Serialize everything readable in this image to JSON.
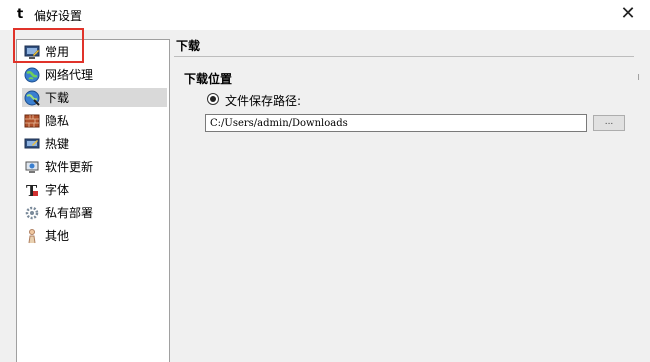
{
  "window": {
    "app_icon": "t",
    "title": "偏好设置",
    "close_glyph": "✕"
  },
  "sidebar": {
    "items": [
      {
        "label": "常用",
        "icon": "monitor-icon",
        "active": false
      },
      {
        "label": "网络代理",
        "icon": "globe-icon",
        "active": false
      },
      {
        "label": "下载",
        "icon": "download-globe-icon",
        "active": true
      },
      {
        "label": "隐私",
        "icon": "brick-wall-icon",
        "active": false
      },
      {
        "label": "热键",
        "icon": "keyboard-icon",
        "active": false
      },
      {
        "label": "软件更新",
        "icon": "update-icon",
        "active": false
      },
      {
        "label": "字体",
        "icon": "font-icon",
        "active": false
      },
      {
        "label": "私有部署",
        "icon": "gear-icon",
        "active": false
      },
      {
        "label": "其他",
        "icon": "person-icon",
        "active": false
      }
    ]
  },
  "panel": {
    "title": "下载",
    "section_title": "下载位置",
    "radio_label": "文件保存路径:",
    "path_value": "C:/Users/admin/Downloads",
    "browse_label": "...",
    "right_marker": "ı"
  },
  "colors": {
    "highlight_box": "#e0332a",
    "selected_row": "#d9d9d9",
    "panel_bg": "#f0f0f0"
  }
}
